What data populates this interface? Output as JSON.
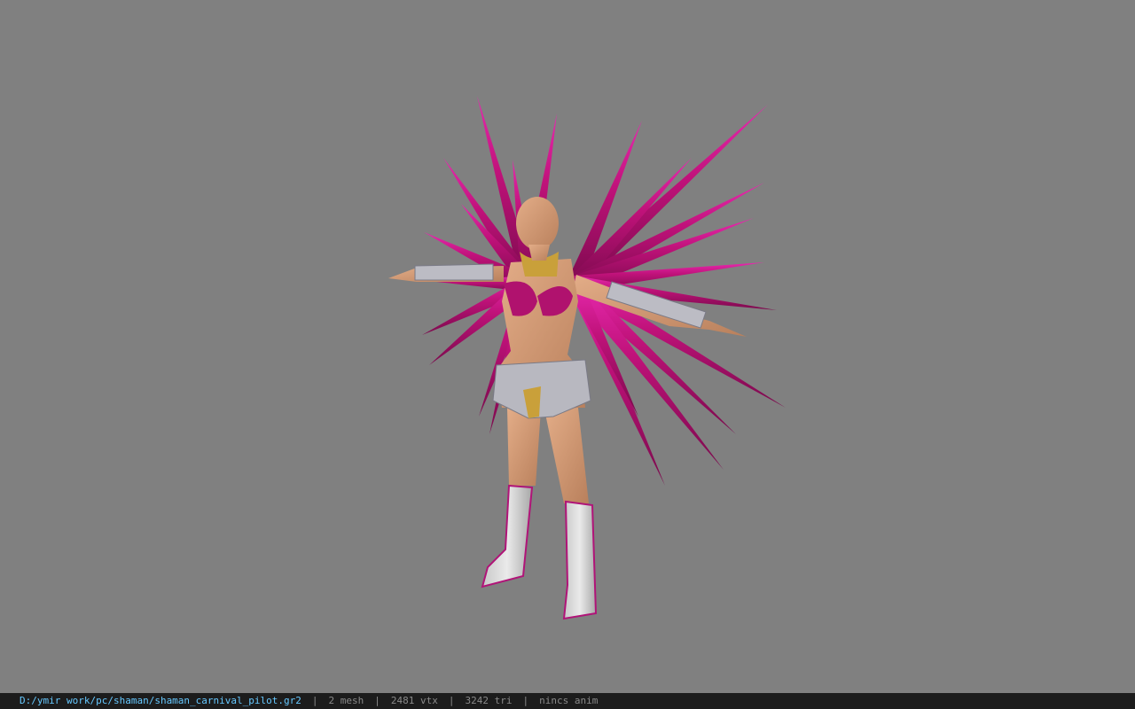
{
  "viewer": {
    "background_color": "#808080",
    "model_primary_color": "#c0127a",
    "model_accent_color": "#e21aa8",
    "skin_color": "#d9a07a"
  },
  "status_bar": {
    "file_path": "D:/ymir work/pc/shaman/shaman_carnival_pilot.gr2",
    "separator": "|",
    "mesh_count": "2 mesh",
    "vertex_count": "2481 vtx",
    "triangle_count": "3242 tri",
    "animation": "nincs anim",
    "path_color": "#66c8ff"
  }
}
